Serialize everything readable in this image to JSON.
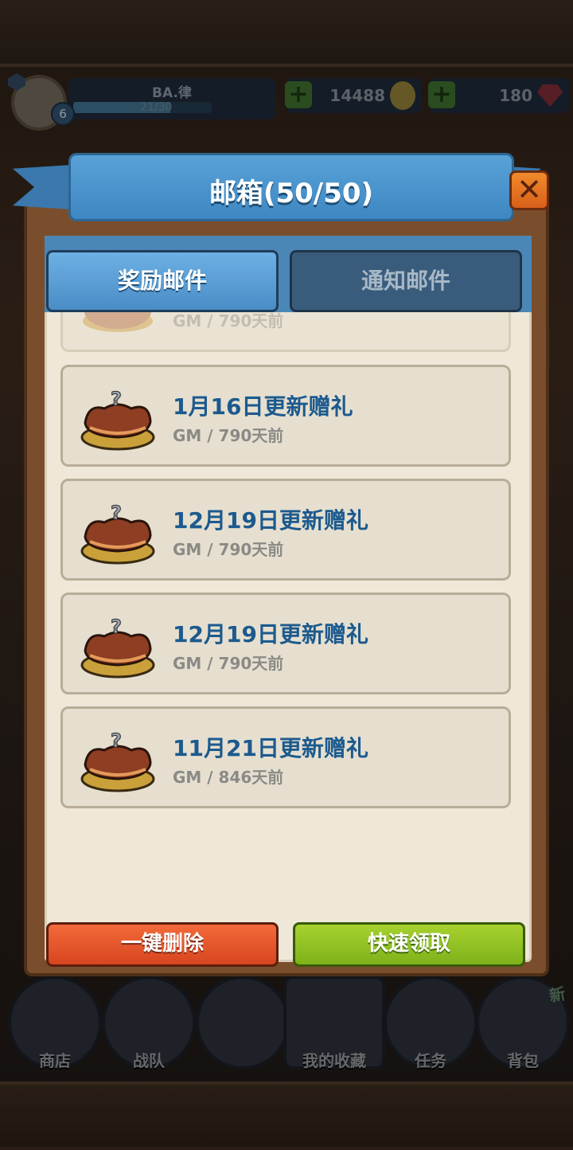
{
  "hud": {
    "player_name": "BA.律",
    "level": "6",
    "xp": "21/30",
    "xp_fraction": 0.7,
    "gold": "14488",
    "gems": "180"
  },
  "mailbox": {
    "title": "邮箱(50/50)",
    "close_symbol": "✕",
    "tabs": [
      {
        "label": "奖励邮件",
        "active": true
      },
      {
        "label": "通知邮件",
        "active": false
      }
    ],
    "mails": [
      {
        "title": "",
        "meta": "GM / 790天前",
        "partial": true
      },
      {
        "title": "1月16日更新赠礼",
        "meta": "GM / 790天前"
      },
      {
        "title": "12月19日更新赠礼",
        "meta": "GM / 790天前"
      },
      {
        "title": "12月19日更新赠礼",
        "meta": "GM / 790天前"
      },
      {
        "title": "11月21日更新赠礼",
        "meta": "GM / 846天前"
      }
    ],
    "delete_all_label": "一键删除",
    "quick_claim_label": "快速领取"
  },
  "bottom_nav": [
    {
      "label": "商店",
      "icon": "shop-cart-icon"
    },
    {
      "label": "战队",
      "icon": "team-banner-icon"
    },
    {
      "label": "",
      "icon": "center-icon"
    },
    {
      "label": "我的收藏",
      "icon": "collection-book-icon"
    },
    {
      "label": "任务",
      "icon": "quest-scroll-icon"
    },
    {
      "label": "背包",
      "icon": "backpack-icon",
      "badge": "新"
    }
  ],
  "colors": {
    "ribbon_blue": "#4a8dc6",
    "mail_title_blue": "#1c5a8e",
    "delete_red": "#e0522a",
    "claim_green": "#8cc224",
    "close_orange": "#e4721f"
  }
}
